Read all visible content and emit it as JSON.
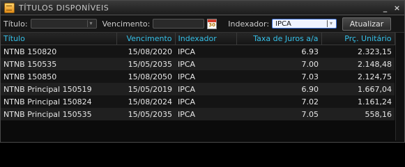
{
  "window": {
    "title": "TÍTULOS DISPONÍVEIS",
    "minimize": "_",
    "close": "×"
  },
  "filters": {
    "titulo_label": "Título:",
    "titulo_value": "",
    "vencimento_label": "Vencimento:",
    "vencimento_value": "",
    "calendar_day": "30",
    "indexador_label": "Indexador:",
    "indexador_value": "IPCA",
    "update_button": "Atualizar"
  },
  "table": {
    "columns": [
      "Título",
      "Vencimento",
      "Indexador",
      "Taxa de Juros a/a",
      "Prç. Unitário"
    ],
    "rows": [
      [
        "NTNB 150820",
        "15/08/2020",
        "IPCA",
        "6.93",
        "2.323,15"
      ],
      [
        "NTNB 150535",
        "15/05/2035",
        "IPCA",
        "7.00",
        "2.148,48"
      ],
      [
        "NTNB 150850",
        "15/08/2050",
        "IPCA",
        "7.03",
        "2.124,75"
      ],
      [
        "NTNB Principal 150519",
        "15/05/2019",
        "IPCA",
        "6.90",
        "1.667,04"
      ],
      [
        "NTNB Principal 150824",
        "15/08/2024",
        "IPCA",
        "7.02",
        "1.161,24"
      ],
      [
        "NTNB Principal 150535",
        "15/05/2035",
        "IPCA",
        "7.05",
        "558,16"
      ]
    ]
  },
  "colors": {
    "header_text": "#35c0e8",
    "accent": "#3b6fd8"
  }
}
